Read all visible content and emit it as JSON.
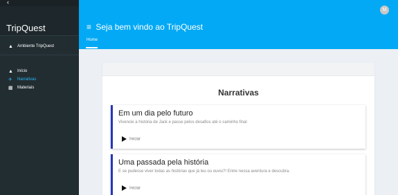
{
  "sidebar": {
    "back_icon": "‹",
    "brand": "TripQuest",
    "environment_icon": "home-icon",
    "environment_label": "Ambiente TripQuest",
    "items": [
      {
        "label": "Início",
        "icon": "home-icon",
        "active": false
      },
      {
        "label": "Narrativas",
        "icon": "airplane-icon",
        "active": true
      },
      {
        "label": "Materiais",
        "icon": "document-icon",
        "active": false
      }
    ]
  },
  "header": {
    "menu_icon": "≡",
    "welcome": "Seja bem vindo ao TripQuest",
    "tab_home": "Home",
    "avatar_letter": "M"
  },
  "main": {
    "title": "Narrativas",
    "stories": [
      {
        "title": "Em um dia pelo futuro",
        "description": "Vivencie a história de Jack e passe pelos desafios até o caminho final",
        "button": "Iniciar"
      },
      {
        "title": "Uma passada pela história",
        "description": "E se pudesse viver todas as histórias que já leu ou ouviu?! Entre nessa aventura e descubra.",
        "button": "Iniciar"
      }
    ]
  },
  "colors": {
    "sidebar_bg": "#222d32",
    "topbar_bg": "#03a9f4",
    "accent_active": "#29b6f6",
    "story_border": "#2536b8",
    "content_bg": "#ecf0f5"
  }
}
